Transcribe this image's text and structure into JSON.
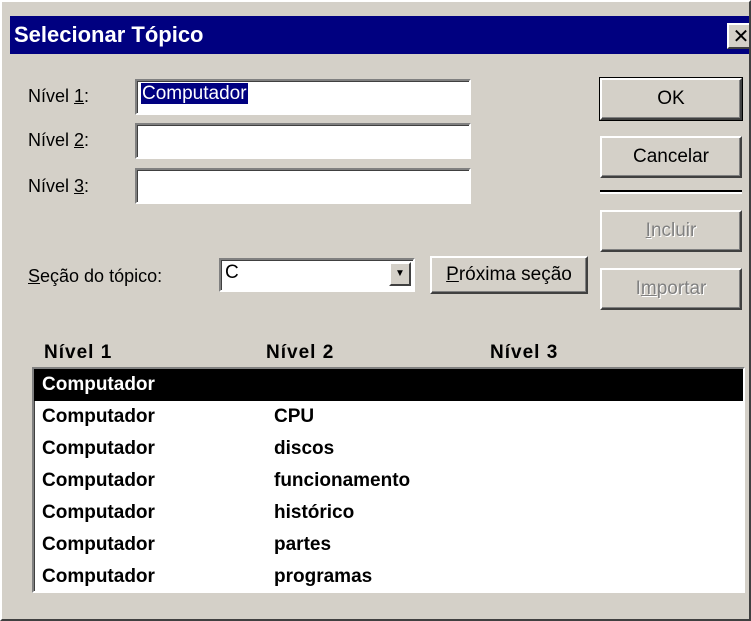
{
  "window": {
    "title": "Selecionar Tópico",
    "close_glyph": "✕"
  },
  "fields": {
    "level1": {
      "label_pre": "Nível ",
      "label_key": "1",
      "label_post": ":",
      "value": "Computador"
    },
    "level2": {
      "label_pre": "Nível ",
      "label_key": "2",
      "label_post": ":",
      "value": ""
    },
    "level3": {
      "label_pre": "Nível ",
      "label_key": "3",
      "label_post": ":",
      "value": ""
    }
  },
  "section": {
    "label_key": "S",
    "label_rest": "eção do tópico:",
    "value": "C",
    "arrow_icon": "▼"
  },
  "buttons": {
    "ok": "OK",
    "cancel": "Cancelar",
    "include_key": "I",
    "include_rest": "ncluir",
    "import_pre": "I",
    "import_key": "m",
    "import_rest": "portar",
    "next_key": "P",
    "next_rest": "róxima seção"
  },
  "list": {
    "columns": [
      "Nível 1",
      "Nível 2",
      "Nível 3"
    ],
    "rows": [
      {
        "c1": "Computador",
        "c2": "",
        "c3": "",
        "selected": true
      },
      {
        "c1": "Computador",
        "c2": "CPU",
        "c3": ""
      },
      {
        "c1": "Computador",
        "c2": "discos",
        "c3": ""
      },
      {
        "c1": "Computador",
        "c2": "funcionamento",
        "c3": ""
      },
      {
        "c1": "Computador",
        "c2": "histórico",
        "c3": ""
      },
      {
        "c1": "Computador",
        "c2": "partes",
        "c3": ""
      },
      {
        "c1": "Computador",
        "c2": "programas",
        "c3": ""
      }
    ]
  },
  "colors": {
    "title_bar": "#000080",
    "dialog_face": "#d4d0c8",
    "selection": "#000000",
    "text_selection": "#000080"
  }
}
